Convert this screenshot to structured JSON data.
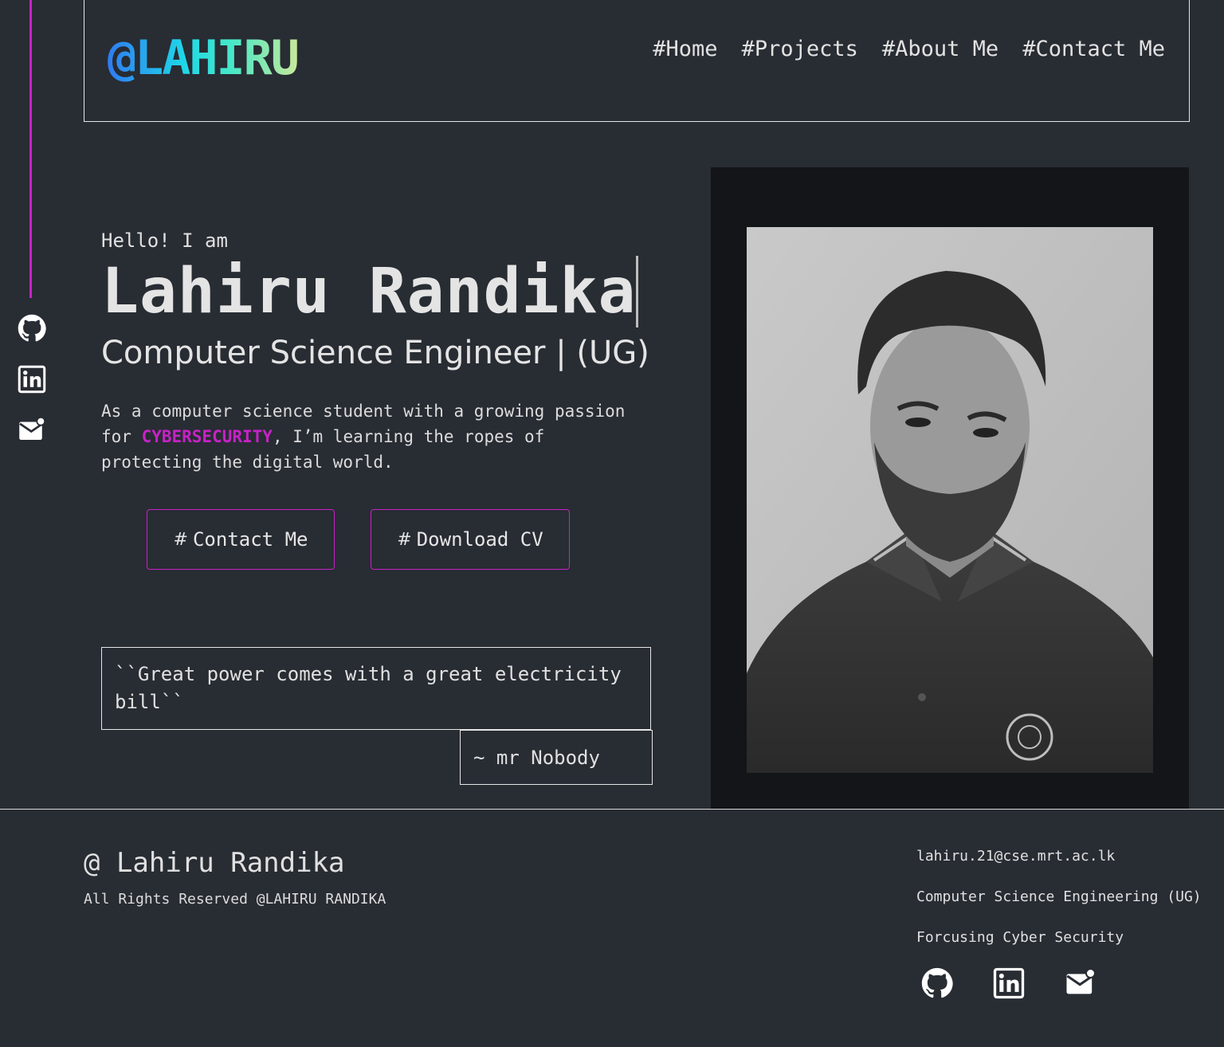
{
  "logo": "@LAHIRU",
  "nav": [
    "#Home",
    "#Projects",
    "#About Me",
    "#Contact Me"
  ],
  "social_icons": [
    "github-icon",
    "linkedin-icon",
    "mail-icon"
  ],
  "hero": {
    "greeting": "Hello! I am",
    "name": "Lahiru Randika",
    "role": "Computer Science Engineer | (UG)",
    "bio_before": "As a computer science student with a growing passion for ",
    "bio_highlight": "CYBERSECURITY",
    "bio_after": ", I’m learning the ropes of protecting the digital world.",
    "highlight_color": "#c722c7",
    "buttons": {
      "contact_hash": "#",
      "contact_label": "Contact Me",
      "cv_hash": "#",
      "cv_label": "Download CV"
    }
  },
  "quote": {
    "text": "``Great power comes with a great electricity bill``",
    "author": "~ mr Nobody"
  },
  "footer": {
    "name": "@ Lahiru Randika",
    "rights": "All Rights Reserved @LAHIRU RANDIKA",
    "email": "lahiru.21@cse.mrt.ac.lk",
    "program": "Computer Science Engineering (UG)",
    "focus": "Forcusing Cyber Security"
  },
  "colors": {
    "background": "#282c33",
    "accent": "#c722c7",
    "photo_frame": "#141519"
  }
}
